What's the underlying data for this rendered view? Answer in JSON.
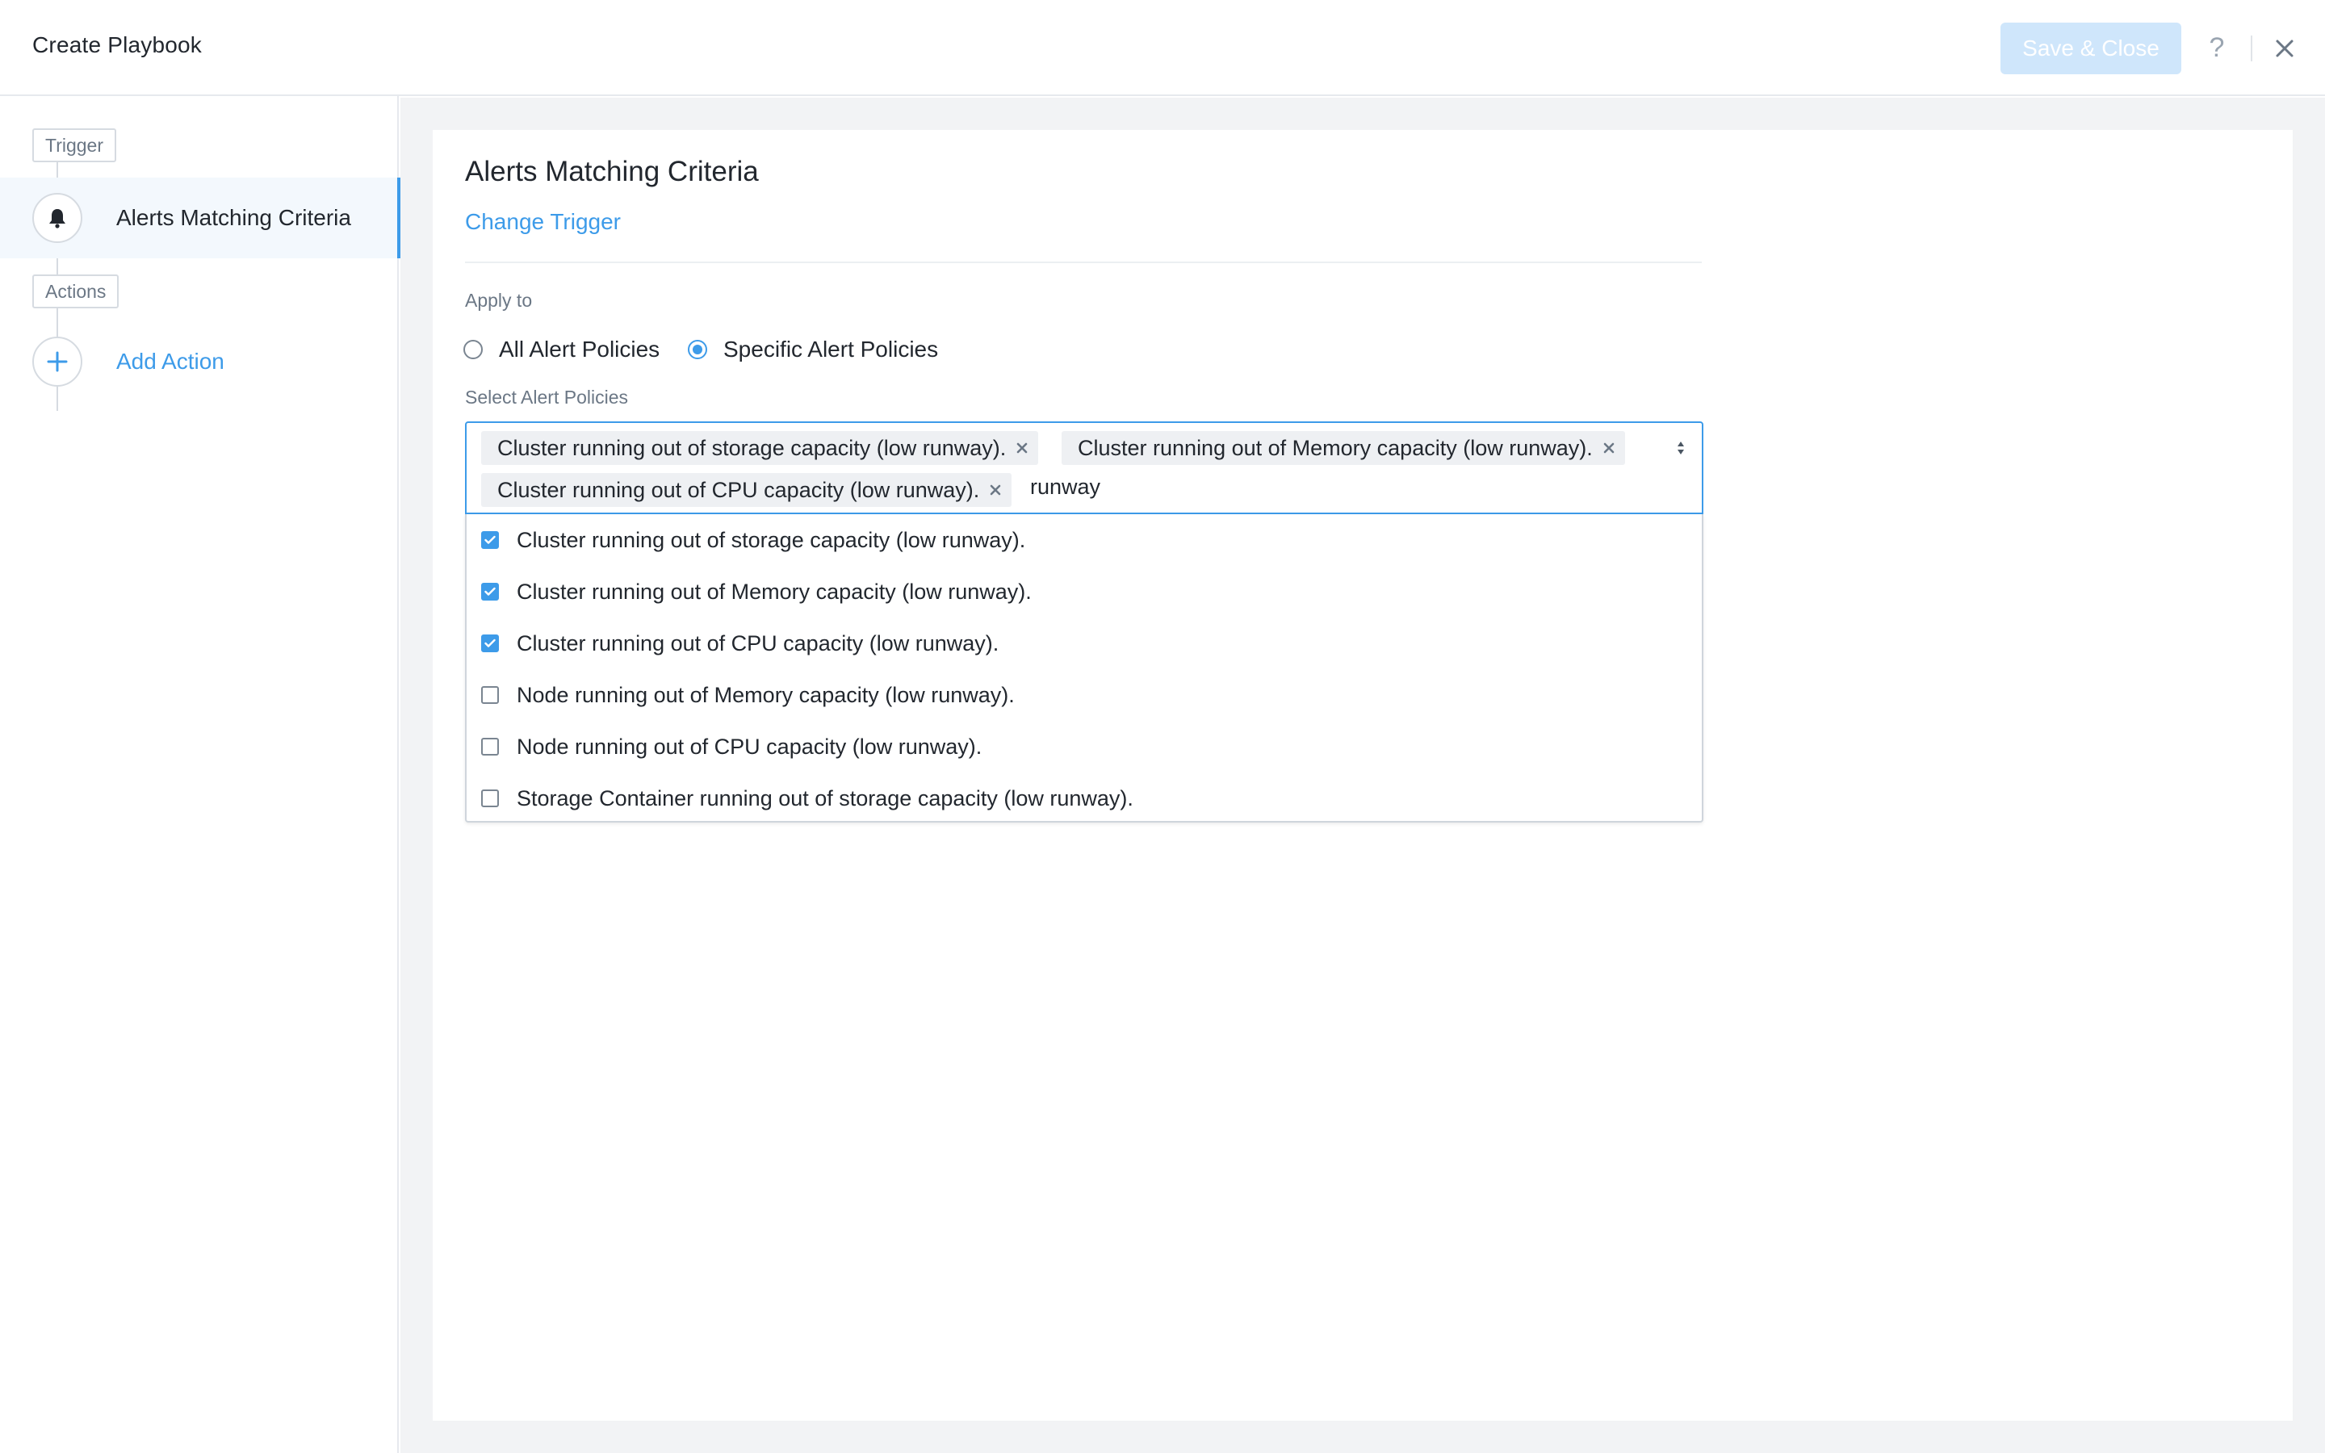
{
  "header": {
    "title": "Create Playbook",
    "save_label": "Save & Close",
    "help_glyph": "?"
  },
  "sidebar": {
    "trigger_tag": "Trigger",
    "trigger_item": "Alerts Matching Criteria",
    "actions_tag": "Actions",
    "add_action": "Add Action"
  },
  "main": {
    "title": "Alerts Matching Criteria",
    "change_trigger": "Change Trigger",
    "apply_to_label": "Apply to",
    "apply_options": [
      {
        "label": "All Alert Policies",
        "selected": false
      },
      {
        "label": "Specific Alert Policies",
        "selected": true
      }
    ],
    "select_label": "Select Alert Policies",
    "selected_tags": [
      "Cluster running out of storage capacity (low runway).",
      "Cluster running out of Memory capacity (low runway).",
      "Cluster running out of CPU capacity (low runway)."
    ],
    "search_value": "runway",
    "options": [
      {
        "label": "Cluster running out of storage capacity (low runway).",
        "checked": true
      },
      {
        "label": "Cluster running out of Memory capacity (low runway).",
        "checked": true
      },
      {
        "label": "Cluster running out of CPU capacity (low runway).",
        "checked": true
      },
      {
        "label": "Node running out of Memory capacity (low runway).",
        "checked": false
      },
      {
        "label": "Node running out of CPU capacity (low runway).",
        "checked": false
      },
      {
        "label": "Storage Container running out of storage capacity (low runway).",
        "checked": false
      }
    ]
  },
  "colors": {
    "accent": "#3d9be9",
    "save_disabled": "#cfe6fb",
    "background": "#f2f3f5"
  },
  "icons": [
    "close-icon",
    "help-icon",
    "bell-icon",
    "plus-icon",
    "remove-tag-icon",
    "sort-arrows-icon",
    "checkmark-icon"
  ]
}
